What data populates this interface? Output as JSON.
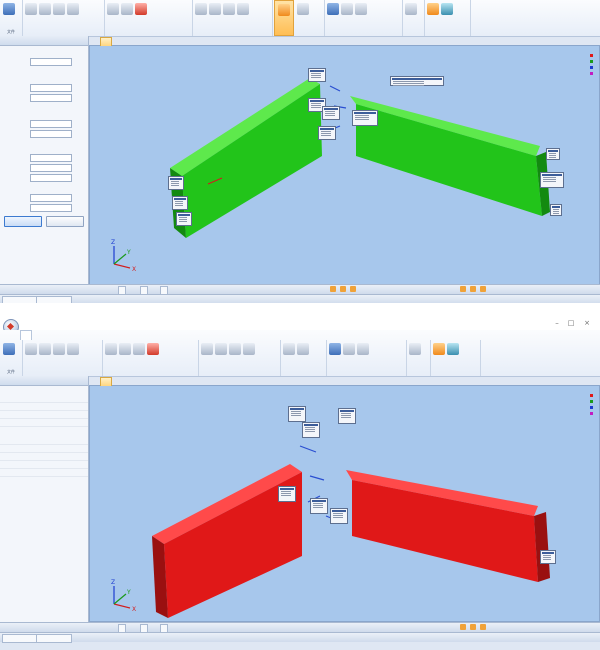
{
  "window1": {
    "ribbon": {
      "group_labels": [
        "文件",
        "",
        "",
        "",
        "",
        "",
        "",
        "",
        ""
      ]
    },
    "panel": {
      "title": "",
      "rows": [
        "",
        "",
        "",
        "",
        "",
        "",
        "",
        "",
        "",
        "",
        "",
        ""
      ],
      "confirm_label": "",
      "cancel_label": ""
    },
    "doc_tab": "",
    "info_lines": "",
    "status_tabs": [
      "",
      "",
      ""
    ]
  },
  "window2": {
    "title": "",
    "ribbon": {
      "tabs": [
        "",
        "",
        "",
        "",
        "",
        "",
        "",
        "",
        ""
      ],
      "group_labels": [
        "文件",
        "",
        "",
        "",
        "",
        "",
        "",
        "",
        ""
      ]
    },
    "panel": {
      "title": "",
      "category1": "",
      "rows1": [
        {
          "key": "",
          "value": ""
        },
        {
          "key": "",
          "value": ""
        },
        {
          "key": "",
          "value": ""
        },
        {
          "key": "",
          "value": ""
        }
      ],
      "category2": "",
      "rows2": [
        {
          "key": "",
          "value": ""
        },
        {
          "key": "",
          "value": ""
        },
        {
          "key": "",
          "value": ""
        },
        {
          "key": "",
          "value": ""
        },
        {
          "key": "",
          "value": ""
        }
      ]
    },
    "doc_tab": "",
    "info_lines": "",
    "status_tabs": [
      "",
      "",
      ""
    ],
    "axes": {
      "x": "X",
      "y": "Y",
      "z": "Z"
    }
  },
  "colors": {
    "beam_green": "#22c41a",
    "beam_green_dark": "#138a10",
    "beam_red": "#e01818",
    "beam_red_dark": "#9a1010",
    "viewport_bg": "#a7c7ec",
    "selected_tool": "#ffbe54"
  }
}
